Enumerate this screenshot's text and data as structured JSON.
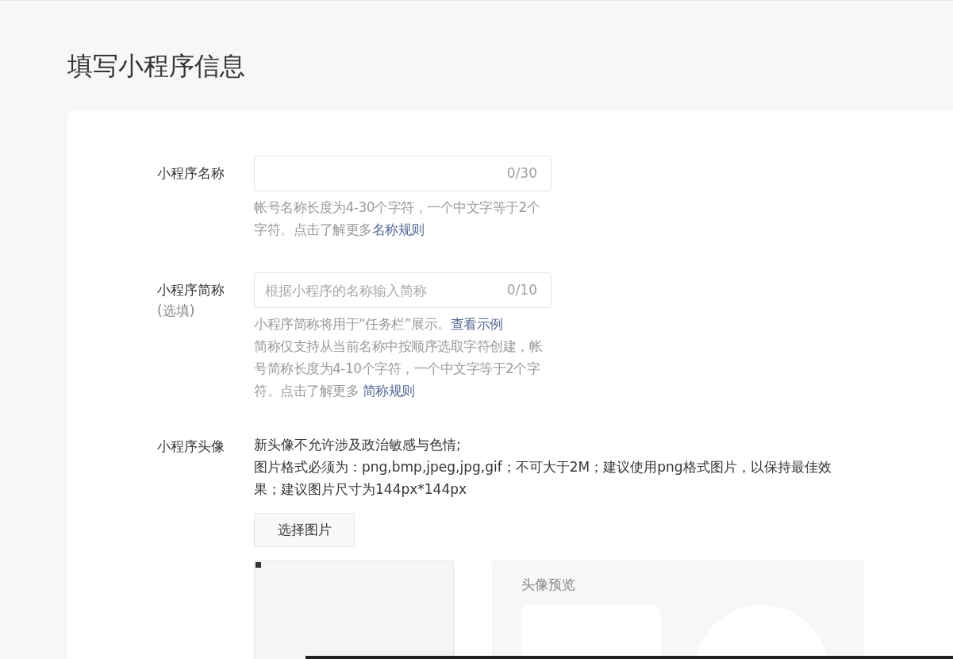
{
  "page_title": "填写小程序信息",
  "fields": [
    {
      "kind": "input",
      "label": "小程序名称",
      "counter": "0/30",
      "hint": [
        [
          {
            "text": "帐号名称长度为4-30个字符，一个中文字等于2个字符。点击了解更多"
          },
          {
            "text": "名称规则",
            "kind": "link"
          }
        ]
      ]
    },
    {
      "kind": "input",
      "label": "小程序简称",
      "sublabel": "(选填)",
      "placeholder": "根据小程序的名称输入简称",
      "counter": "0/10",
      "hint": [
        [
          {
            "text": "小程序简称将用于“任务栏”展示。"
          },
          {
            "text": "查看示例",
            "kind": "link"
          }
        ],
        [
          {
            "text": "简称仅支持从当前名称中按顺序选取字符创建，帐号简称长度为4-10个字符，一个中文字等于2个字符。点击了解更多 "
          },
          {
            "text": "简称规则",
            "kind": "link"
          }
        ]
      ]
    },
    {
      "kind": "avatar",
      "label": "小程序头像",
      "notes": [
        "新头像不允许涉及政治敏感与色情;",
        "图片格式必须为：png,bmp,jpeg,jpg,gif；不可大于2M；建议使用png格式图片，以保持最佳效果；建议图片尺寸为144px*144px"
      ],
      "button": "选择图片",
      "preview_title": "头像预览"
    }
  ]
}
